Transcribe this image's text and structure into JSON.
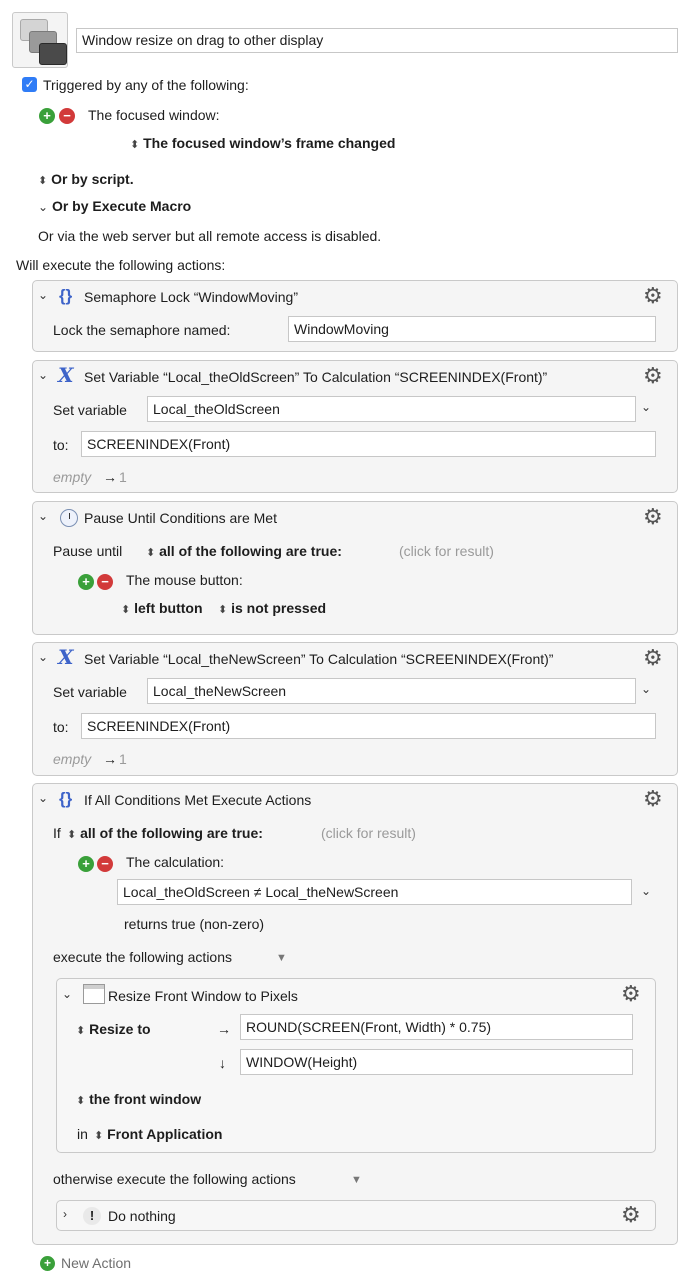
{
  "macro": {
    "name": "Window resize on drag to other display"
  },
  "trigger": {
    "checked": true,
    "label": "Triggered by any of the following:",
    "focused_window_label": "The focused window:",
    "focused_window_event": "The focused window’s frame changed",
    "or_by_script": "Or by script.",
    "or_by_execute_macro": "Or by Execute Macro",
    "web_server_note": "Or via the web server but all remote access is disabled."
  },
  "actions_header": "Will execute the following actions:",
  "actions": {
    "semaphore": {
      "title": "Semaphore Lock “WindowMoving”",
      "field_label": "Lock the semaphore named:",
      "field_value": "WindowMoving"
    },
    "set_old": {
      "title": "Set Variable “Local_theOldScreen” To Calculation “SCREENINDEX(Front)”",
      "var_label": "Set variable",
      "var_value": "Local_theOldScreen",
      "to_label": "to:",
      "to_value": "SCREENINDEX(Front)",
      "result_prefix": "empty",
      "result_value": "1"
    },
    "pause": {
      "title": "Pause Until Conditions are Met",
      "pause_label": "Pause until",
      "condition_mode": "all of the following are true:",
      "click_for_result": "(click for result)",
      "mouse_label": "The mouse button:",
      "button_value": "left button",
      "state_value": "is not pressed"
    },
    "set_new": {
      "title": "Set Variable “Local_theNewScreen” To Calculation “SCREENINDEX(Front)”",
      "var_label": "Set variable",
      "var_value": "Local_theNewScreen",
      "to_label": "to:",
      "to_value": "SCREENINDEX(Front)",
      "result_prefix": "empty",
      "result_value": "1"
    },
    "if_all": {
      "title": "If All Conditions Met Execute Actions",
      "if_label": "If",
      "condition_mode": "all of the following are true:",
      "click_for_result": "(click for result)",
      "calc_label": "The calculation:",
      "calc_value": "Local_theOldScreen ≠ Local_theNewScreen",
      "returns_note": "returns true (non-zero)",
      "execute_label": "execute the following actions",
      "resize": {
        "title": "Resize Front Window to Pixels",
        "resize_label": "Resize to",
        "width_value": "ROUND(SCREEN(Front, Width) * 0.75)",
        "height_value": "WINDOW(Height)",
        "window_target": "the front window",
        "in_label": "in",
        "app_target": "Front Application"
      },
      "otherwise_label": "otherwise execute the following actions",
      "do_nothing": "Do nothing"
    }
  },
  "new_action": "New Action",
  "colors": {
    "accent_blue": "#2f7cf6",
    "plus_green": "#3aa03a",
    "minus_red": "#d23a3a",
    "action_bg": "#f5f5f5"
  }
}
